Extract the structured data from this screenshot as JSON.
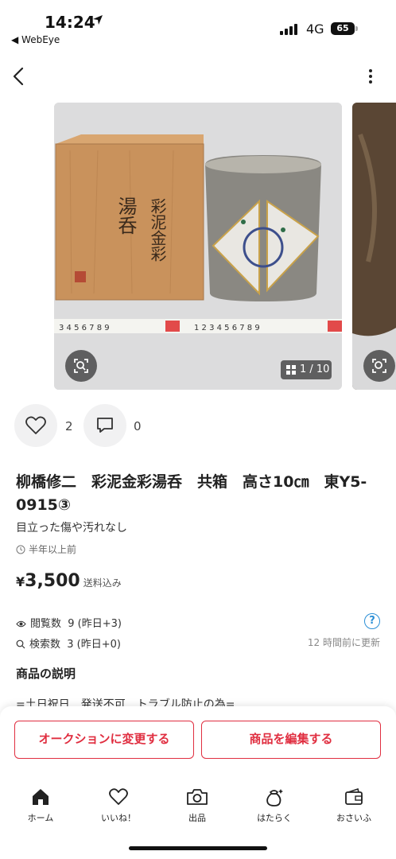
{
  "status_bar": {
    "time": "14:24",
    "back_app": "◀ WebEye",
    "network": "4G",
    "battery": "65"
  },
  "gallery": {
    "counter": "1 / 10",
    "box_text_1": "彩泥金彩",
    "box_text_2": "湯呑"
  },
  "social": {
    "likes": "2",
    "comments": "0"
  },
  "item": {
    "title": "柳橋修二　彩泥金彩湯呑　共箱　高さ10㎝　東Y5-0915③",
    "subtitle": "目立った傷や汚れなし",
    "posted": "半年以上前",
    "price_symbol": "¥",
    "price": "3,500",
    "shipping": "送料込み"
  },
  "stats": {
    "views_label": "閲覧数",
    "views_value": "9 (昨日+3)",
    "search_label": "検索数",
    "search_value": "3 (昨日+0)",
    "help": "?",
    "updated": "12 時間前に更新"
  },
  "description": {
    "heading": "商品の説明",
    "first_line": "=土日祝日　発送不可　トラブル防止の為="
  },
  "actions": {
    "change_auction": "オークションに変更する",
    "edit_item": "商品を編集する"
  },
  "tabs": [
    {
      "label": "ホーム",
      "icon": "home-icon"
    },
    {
      "label": "いいね！",
      "icon": "heart-icon"
    },
    {
      "label": "出品",
      "icon": "camera-icon"
    },
    {
      "label": "はたらく",
      "icon": "bag-sparkle-icon"
    },
    {
      "label": "おさいふ",
      "icon": "wallet-icon"
    }
  ],
  "colors": {
    "accent": "#e02e40",
    "help_blue": "#2b8fd6"
  }
}
